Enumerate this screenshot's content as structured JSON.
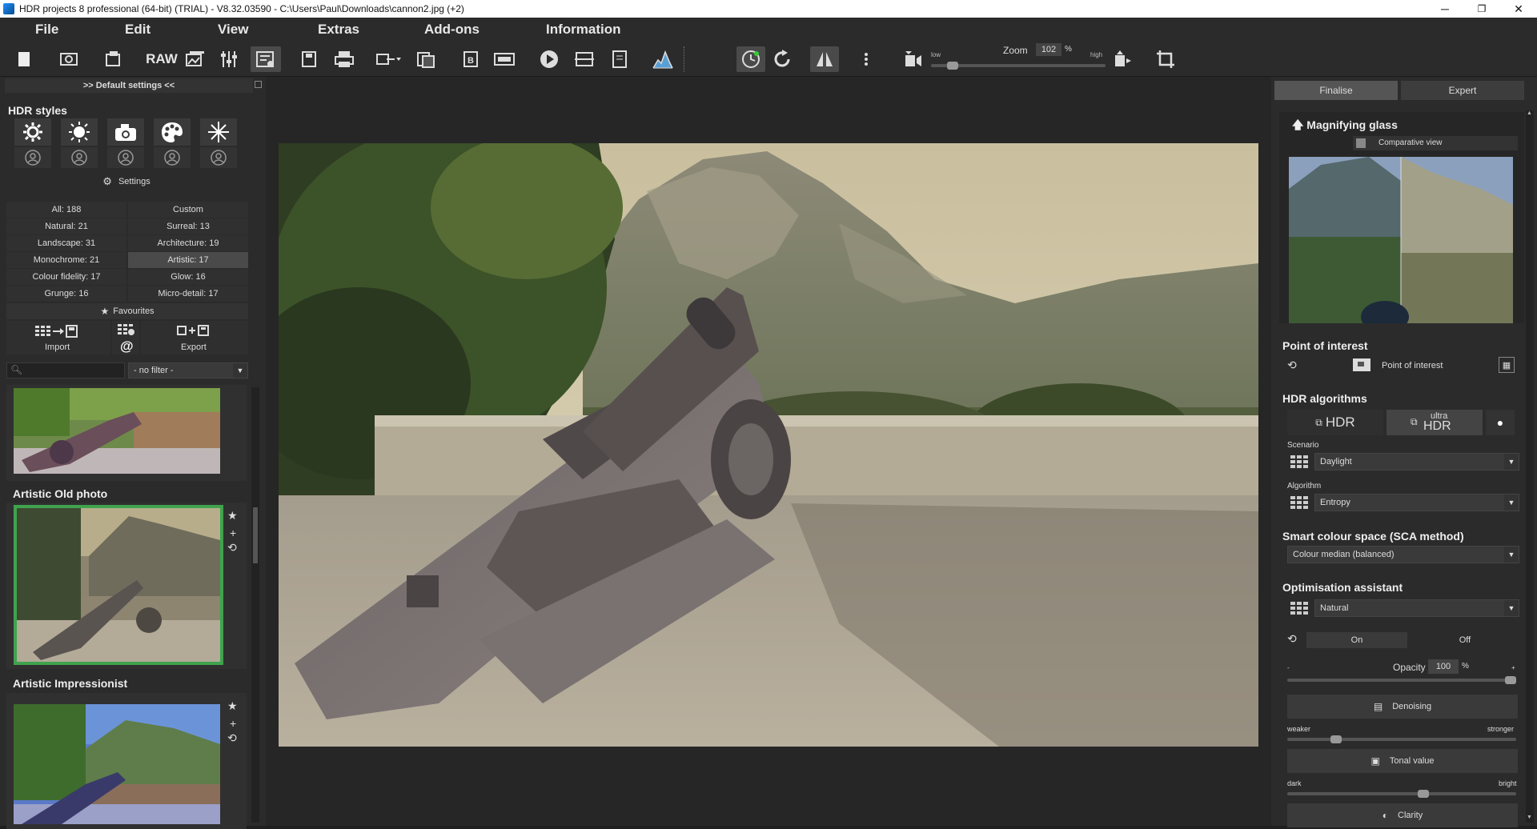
{
  "window": {
    "title": "HDR projects 8 professional (64-bit) (TRIAL) - V8.32.03590 - C:\\Users\\Paul\\Downloads\\cannon2.jpg (+2)",
    "minimize": "─",
    "maximize": "❐",
    "close": "✕"
  },
  "menu": [
    "File",
    "Edit",
    "View",
    "Extras",
    "Add-ons",
    "Information"
  ],
  "toolbar": {
    "raw_label": "RAW",
    "zoom_label": "Zoom",
    "zoom_value": "102",
    "zoom_unit": "%",
    "low_label": "low",
    "high_label": "high",
    "active_icon": "preset-browser-icon"
  },
  "left": {
    "header": ">> Default settings <<",
    "hdr_styles_title": "HDR styles",
    "settings_label": "Settings",
    "categories": [
      [
        "All: 188",
        "Custom"
      ],
      [
        "Natural: 21",
        "Surreal: 13"
      ],
      [
        "Landscape: 31",
        "Architecture: 19"
      ],
      [
        "Monochrome: 21",
        "Artistic: 17"
      ],
      [
        "Colour fidelity: 17",
        "Glow: 16"
      ],
      [
        "Grunge: 16",
        "Micro-detail: 17"
      ]
    ],
    "selected_category": "Artistic: 17",
    "favourites_label": "Favourites",
    "import_label": "Import",
    "export_label": "Export",
    "at_label": "@",
    "filter_value": "- no filter -",
    "presets": [
      {
        "title": "",
        "selected": false
      },
      {
        "title": "Artistic Old photo",
        "selected": true
      },
      {
        "title": "Artistic Impressionist",
        "selected": false
      }
    ]
  },
  "right": {
    "tabs": [
      "Finalise",
      "Expert"
    ],
    "active_tab": "Finalise",
    "magnifier_title": "Magnifying glass",
    "comparative_view": "Comparative view",
    "poi_title": "Point of interest",
    "poi_button": "Point of interest",
    "hdr_algorithms_title": "HDR algorithms",
    "hdr_button": "HDR",
    "ultra_top": "ultra",
    "ultra_bottom": "HDR",
    "scenario_label": "Scenario",
    "scenario_value": "Daylight",
    "algorithm_label": "Algorithm",
    "algorithm_value": "Entropy",
    "sca_title": "Smart colour space (SCA method)",
    "sca_value": "Colour median (balanced)",
    "opt_title": "Optimisation assistant",
    "opt_value": "Natural",
    "on_label": "On",
    "off_label": "Off",
    "opacity_label": "Opacity",
    "opacity_value": "100",
    "opacity_unit": "%",
    "opacity_level": 1.0,
    "denoising_label": "Denoising",
    "weaker_label": "weaker",
    "stronger_label": "stronger",
    "denoising_level": 0.2,
    "tonal_label": "Tonal value",
    "dark_label": "dark",
    "bright_label": "bright",
    "tonal_level": 0.6,
    "clarity_label": "Clarity",
    "minus": "-",
    "plus": "+"
  },
  "zoom_slider_level": 0.1
}
